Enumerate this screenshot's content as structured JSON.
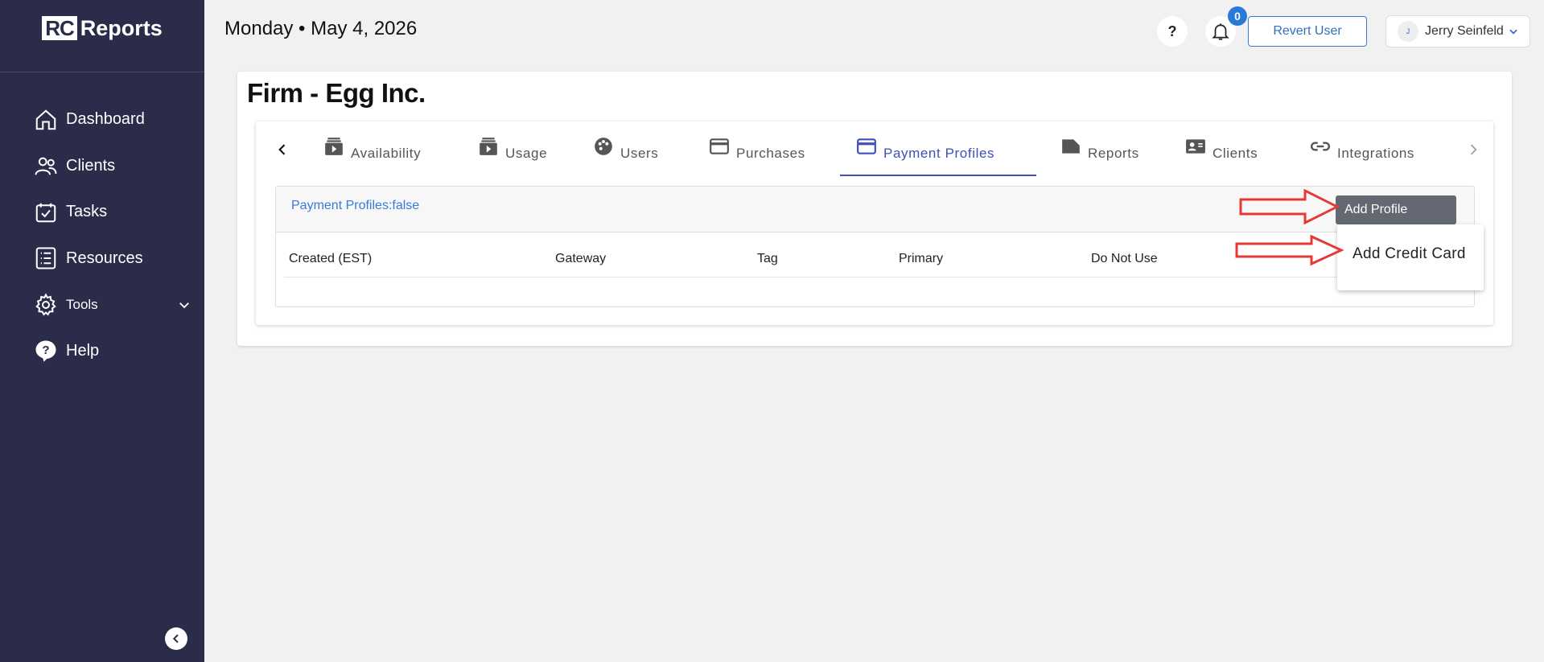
{
  "logo": {
    "mark": "RC",
    "text": "Reports"
  },
  "sidebar": {
    "items": [
      {
        "label": "Dashboard",
        "icon": "home-icon"
      },
      {
        "label": "Clients",
        "icon": "users-icon"
      },
      {
        "label": "Tasks",
        "icon": "calendar-check-icon"
      },
      {
        "label": "Resources",
        "icon": "list-icon"
      },
      {
        "label": "Tools",
        "icon": "gear-icon"
      },
      {
        "label": "Help",
        "icon": "help-bubble-icon"
      }
    ]
  },
  "header": {
    "date": "Monday • May 4, 2026",
    "help_label": "?",
    "notification_count": "0",
    "revert_label": "Revert User",
    "user_initial": "J",
    "user_name": "Jerry Seinfeld"
  },
  "page": {
    "title": "Firm - Egg Inc."
  },
  "tabs": [
    {
      "label": "Availability",
      "icon": "stack-play-icon"
    },
    {
      "label": "Usage",
      "icon": "stack-play-icon"
    },
    {
      "label": "Users",
      "icon": "palette-icon"
    },
    {
      "label": "Purchases",
      "icon": "credit-card-icon"
    },
    {
      "label": "Payment Profiles",
      "icon": "credit-card-icon",
      "active": true
    },
    {
      "label": "Reports",
      "icon": "label-icon"
    },
    {
      "label": "Clients",
      "icon": "contact-card-icon"
    },
    {
      "label": "Integrations",
      "icon": "link-icon"
    }
  ],
  "panel": {
    "title": "Payment Profiles:false",
    "add_profile_label": "Add Profile",
    "columns": [
      "Created (EST)",
      "Gateway",
      "Tag",
      "Primary",
      "Do Not Use"
    ]
  },
  "dropdown": {
    "items": [
      "Add Credit Card"
    ]
  },
  "colors": {
    "sidebar_bg": "#2b2b4a",
    "accent": "#3f51b5",
    "link_blue": "#3a7bd5",
    "annotation_red": "#e53935"
  }
}
